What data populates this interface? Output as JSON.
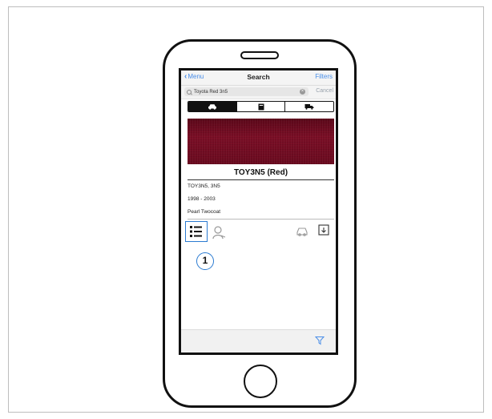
{
  "nav": {
    "back_label": "Menu",
    "title": "Search",
    "filters_label": "Filters"
  },
  "search": {
    "query": "Toyota Red 3n5",
    "clear_glyph": "×",
    "cancel_label": "Cancel"
  },
  "segments": [
    {
      "icon": "car-icon",
      "selected": true
    },
    {
      "icon": "book-icon",
      "selected": false
    },
    {
      "icon": "truck-icon",
      "selected": false
    }
  ],
  "color": {
    "swatch_hex": "#6e0b22",
    "title": "TOY3N5 (Red)"
  },
  "details": {
    "codes": "TOY3N5, 3N5",
    "years": "1998 - 2003",
    "finish": "Pearl Twocoat"
  },
  "toolbar": {
    "icons": [
      "list-icon",
      "person-icon",
      "car-outline-icon",
      "download-icon"
    ]
  },
  "callout": {
    "number": "1"
  },
  "bottom": {
    "icon": "filter-icon"
  },
  "colors": {
    "accent": "#4a8ee8",
    "highlight": "#2b7bd1"
  }
}
